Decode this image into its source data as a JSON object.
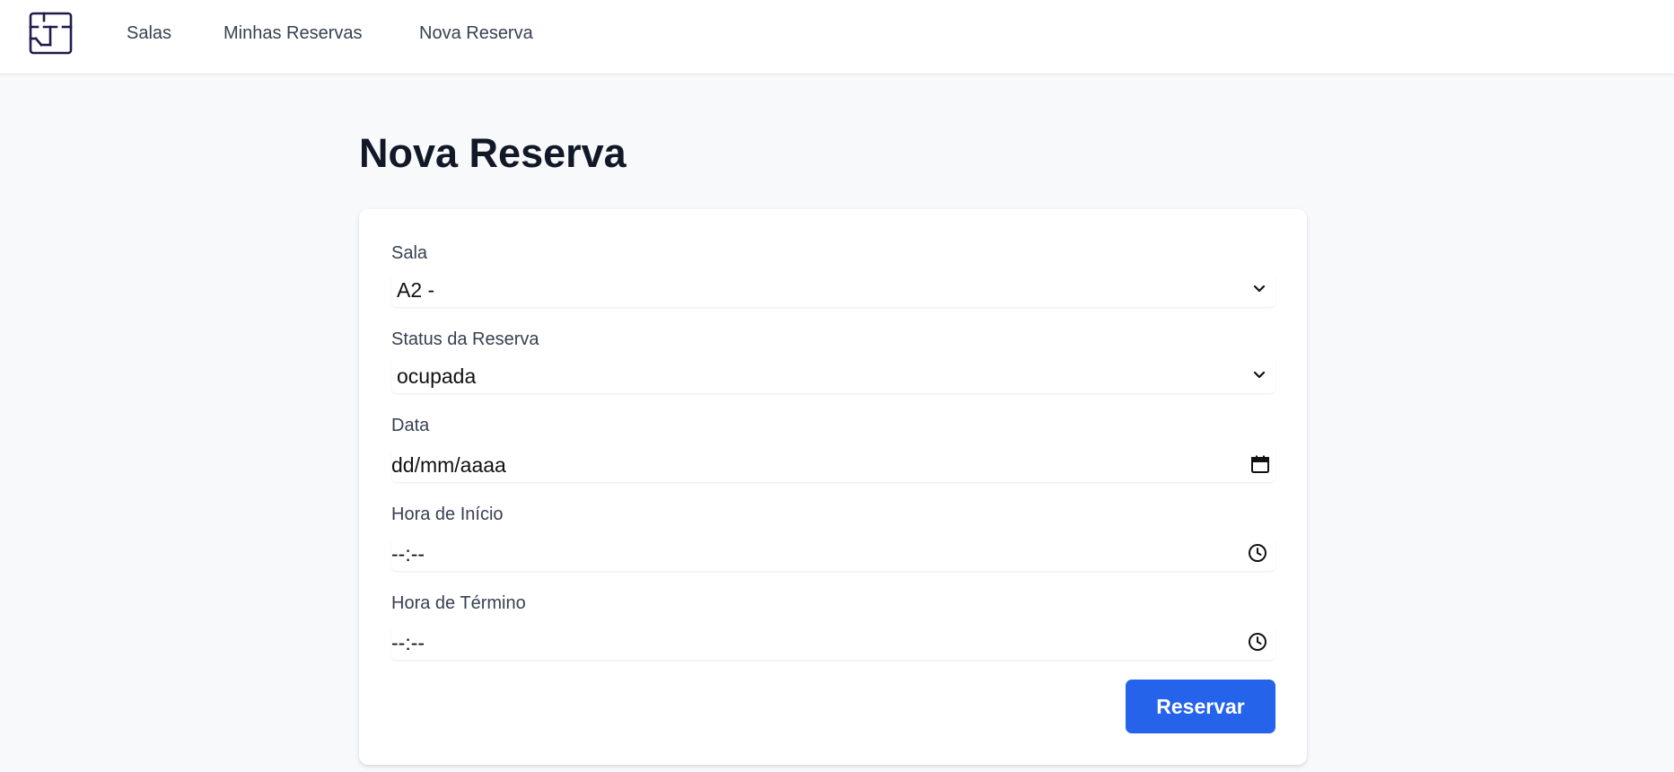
{
  "nav": {
    "logo_icon": "floor-plan-logo-icon",
    "links": [
      "Salas",
      "Minhas Reservas",
      "Nova Reserva"
    ]
  },
  "page": {
    "title": "Nova Reserva"
  },
  "form": {
    "sala": {
      "label": "Sala",
      "value": "A2 -",
      "icon": "chevron-down-icon"
    },
    "status": {
      "label": "Status da Reserva",
      "value": "ocupada",
      "icon": "chevron-down-icon"
    },
    "data": {
      "label": "Data",
      "placeholder": "dd/mm/aaaa",
      "icon": "calendar-icon"
    },
    "hora_inicio": {
      "label": "Hora de Início",
      "placeholder": "--:--",
      "icon": "clock-icon"
    },
    "hora_termino": {
      "label": "Hora de Término",
      "placeholder": "--:--",
      "icon": "clock-icon"
    },
    "submit_label": "Reservar"
  },
  "colors": {
    "primary": "#2563eb",
    "logo": "#1e1b4b",
    "background": "#f8f9fb",
    "heading": "#111827"
  }
}
